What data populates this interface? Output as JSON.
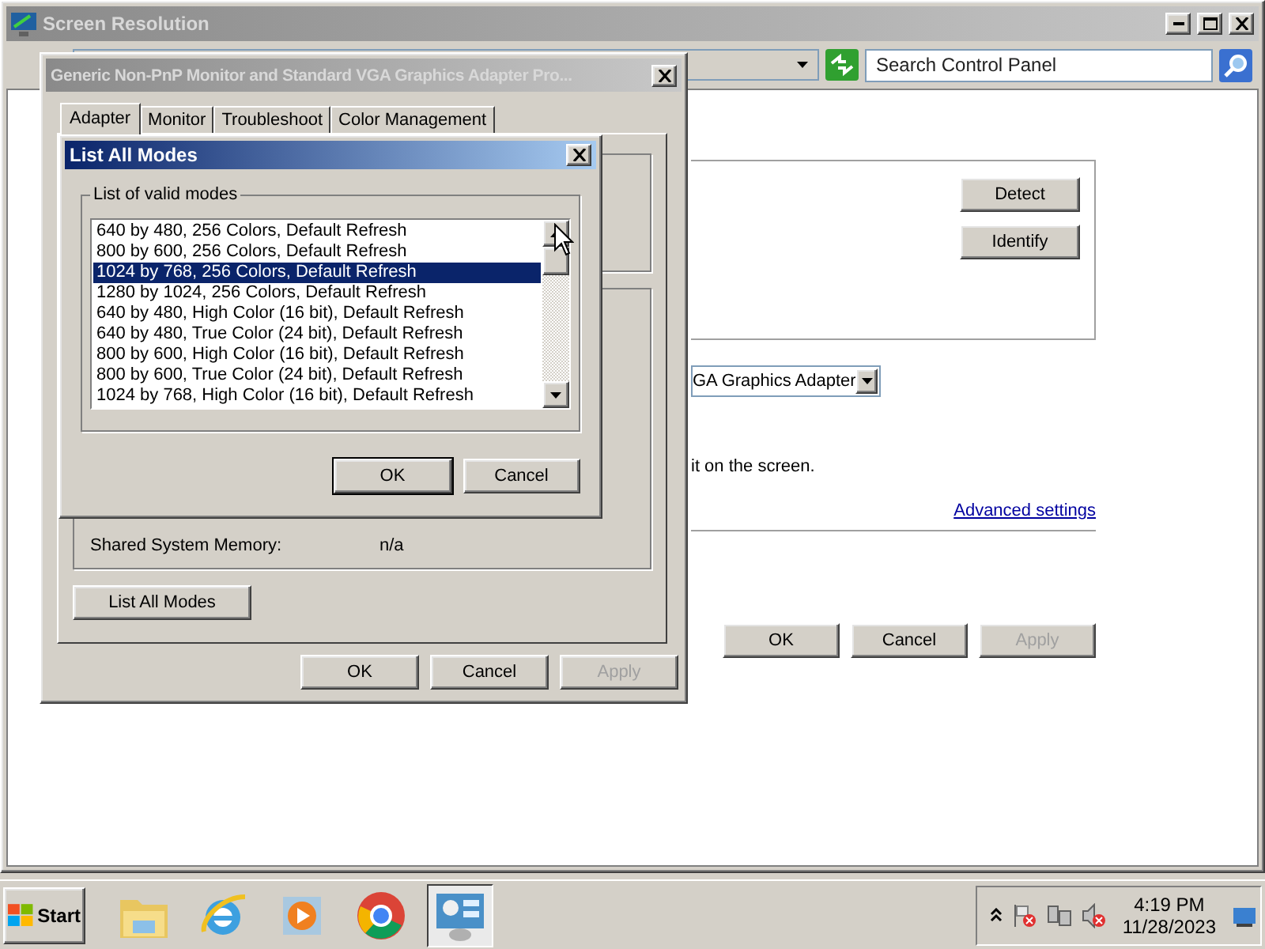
{
  "main_window": {
    "title": "Screen Resolution",
    "search": {
      "placeholder": "Search Control Panel"
    },
    "display_buttons": [
      "Detect",
      "Identify"
    ],
    "adapter_dropdown": "GA Graphics Adapter",
    "hint_text": "it on the screen.",
    "advanced_link": "Advanced settings",
    "buttons": [
      {
        "label": "OK",
        "disabled": false
      },
      {
        "label": "Cancel",
        "disabled": false
      },
      {
        "label": "Apply",
        "disabled": true
      }
    ]
  },
  "properties_dialog": {
    "title": "Generic Non-PnP Monitor and Standard VGA Graphics Adapter Pro...",
    "tabs": [
      {
        "label": "Adapter",
        "selected": true
      },
      {
        "label": "Monitor",
        "selected": false
      },
      {
        "label": "Troubleshoot",
        "selected": false
      },
      {
        "label": "Color Management",
        "selected": false
      }
    ],
    "info_rows": [
      {
        "label": "Shared System Memory:",
        "value": "n/a"
      }
    ],
    "list_button": "List All Modes",
    "buttons": [
      {
        "label": "OK",
        "disabled": false
      },
      {
        "label": "Cancel",
        "disabled": false
      },
      {
        "label": "Apply",
        "disabled": true
      }
    ]
  },
  "modes_dialog": {
    "title": "List All Modes",
    "group_label": "List of valid modes",
    "modes": [
      {
        "label": "640 by 480, 256 Colors, Default Refresh",
        "selected": false
      },
      {
        "label": "800 by 600, 256 Colors, Default Refresh",
        "selected": false
      },
      {
        "label": "1024 by 768, 256 Colors, Default Refresh",
        "selected": true
      },
      {
        "label": "1280 by 1024, 256 Colors, Default Refresh",
        "selected": false
      },
      {
        "label": "640 by 480, High Color (16 bit), Default Refresh",
        "selected": false
      },
      {
        "label": "640 by 480, True Color (24 bit), Default Refresh",
        "selected": false
      },
      {
        "label": "800 by 600, High Color (16 bit), Default Refresh",
        "selected": false
      },
      {
        "label": "800 by 600, True Color (24 bit), Default Refresh",
        "selected": false
      },
      {
        "label": "1024 by 768, High Color (16 bit), Default Refresh",
        "selected": false
      }
    ],
    "buttons": [
      {
        "label": "OK",
        "default": true
      },
      {
        "label": "Cancel",
        "default": false
      }
    ]
  },
  "taskbar": {
    "start": "Start",
    "apps": [
      {
        "kind": "folder",
        "active": false
      },
      {
        "kind": "browser",
        "active": false
      },
      {
        "kind": "media",
        "active": false
      },
      {
        "kind": "globe",
        "active": false
      },
      {
        "kind": "control",
        "active": true
      }
    ],
    "clock": {
      "time": "4:19 PM",
      "date": "11/28/2023"
    }
  }
}
